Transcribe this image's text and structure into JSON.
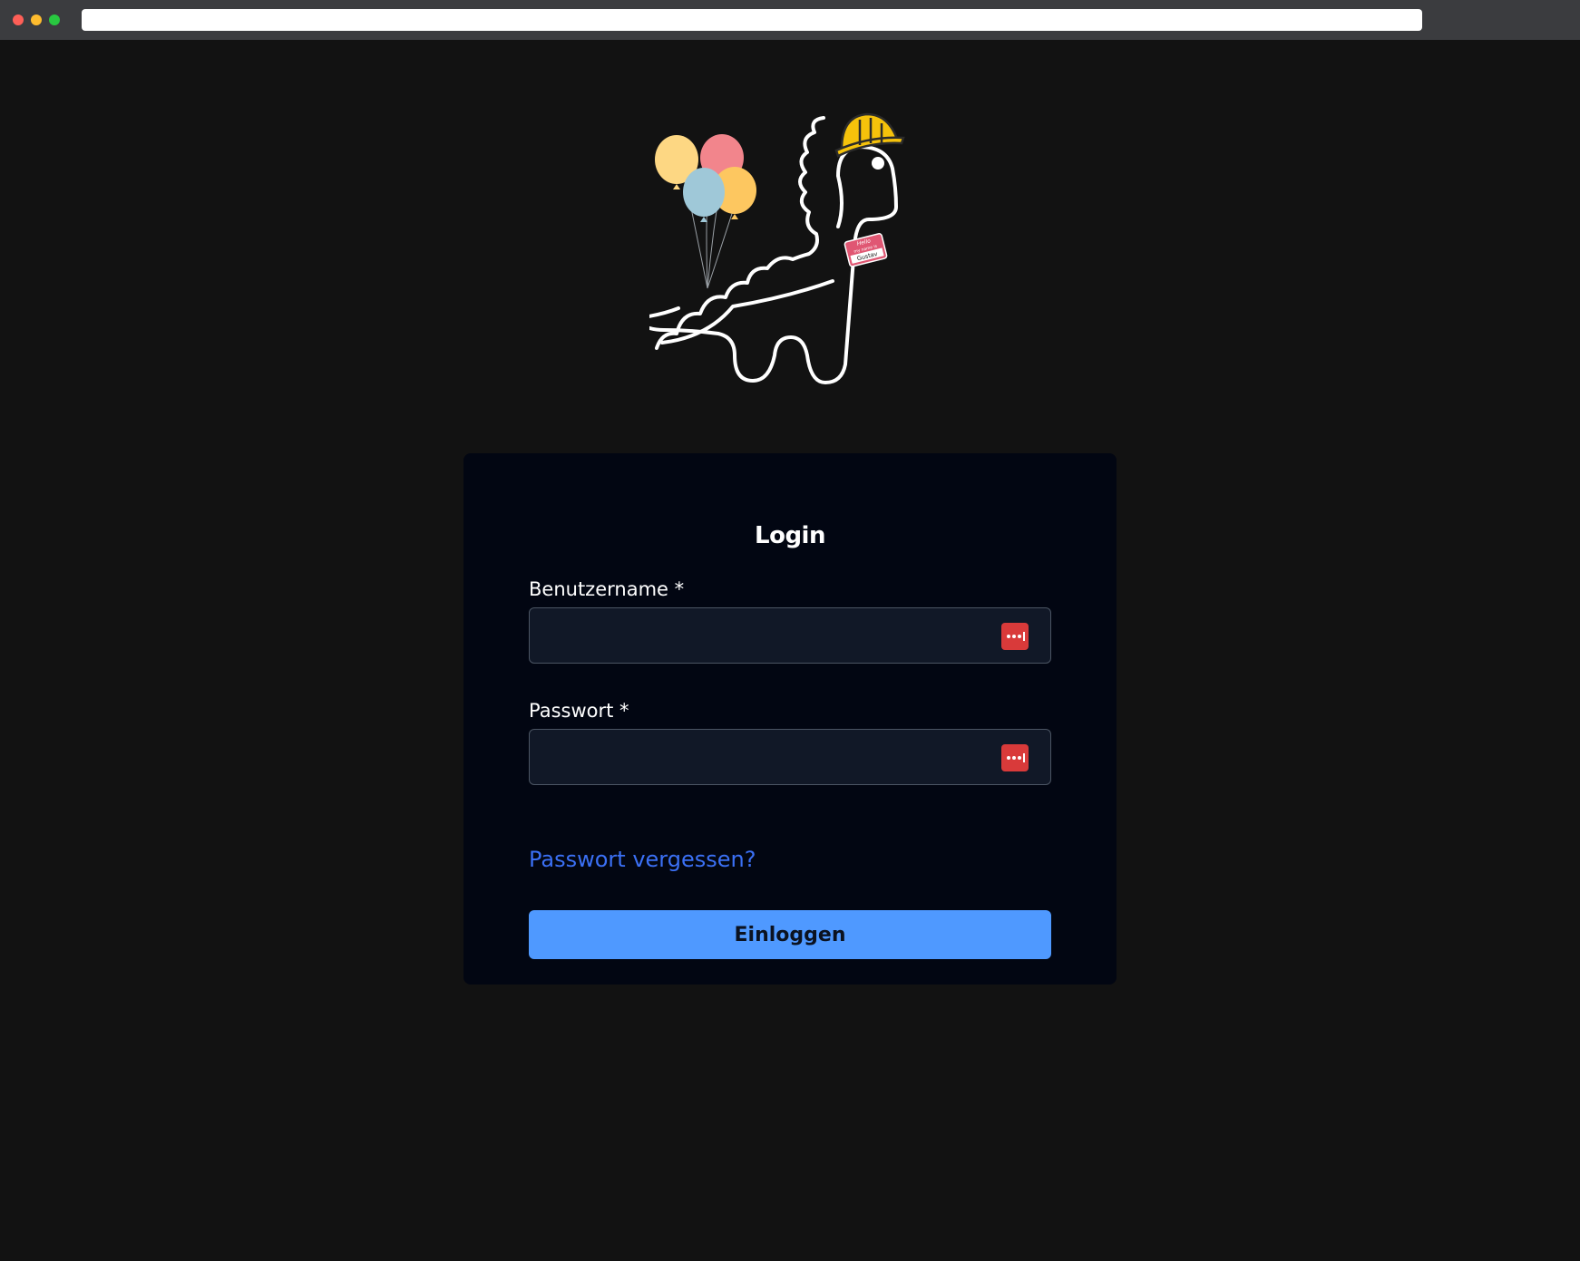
{
  "browser": {
    "address_bar_value": ""
  },
  "mascot": {
    "name_tag_greeting": "Hello",
    "name_tag_subtitle": "my name is",
    "name_tag_name": "Gustav"
  },
  "login_form": {
    "title": "Login",
    "username_label": "Benutzername *",
    "username_value": "",
    "password_label": "Passwort *",
    "password_value": "",
    "forgot_password_link": "Passwort vergessen?",
    "submit_label": "Einloggen"
  },
  "colors": {
    "page_background": "#121212",
    "card_background": "#020612",
    "input_background": "#111827",
    "input_border": "#4b5563",
    "accent_button": "#4f99ff",
    "link": "#3b70f5",
    "password_manager_icon": "#d93a3a"
  },
  "icons": {
    "field_icon": "password-manager-icon"
  }
}
